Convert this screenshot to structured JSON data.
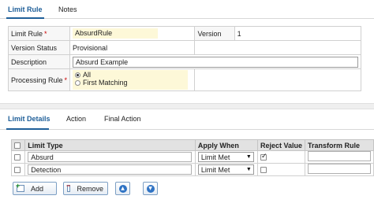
{
  "top_tabs": [
    {
      "label": "Limit Rule",
      "active": true
    },
    {
      "label": "Notes",
      "active": false
    }
  ],
  "limit_rule": {
    "limit_rule_label": "Limit Rule",
    "limit_rule_value": "AbsurdRule",
    "version_label": "Version",
    "version_value": "1",
    "version_status_label": "Version Status",
    "version_status_value": "Provisional",
    "description_label": "Description",
    "description_value": "Absurd Example",
    "processing_rule_label": "Processing Rule",
    "processing_options": [
      {
        "label": "All",
        "selected": true
      },
      {
        "label": "First Matching",
        "selected": false
      }
    ],
    "required_marker": "*"
  },
  "detail_tabs": [
    {
      "label": "Limit Details",
      "active": true
    },
    {
      "label": "Action",
      "active": false
    },
    {
      "label": "Final Action",
      "active": false
    }
  ],
  "grid": {
    "headers": [
      "Limit Type",
      "Apply When",
      "Reject Value",
      "Transform Rule"
    ],
    "rows": [
      {
        "limit_type": "Absurd",
        "apply_when": "Limit Met",
        "reject": true,
        "transform": ""
      },
      {
        "limit_type": "Detection",
        "apply_when": "Limit Met",
        "reject": false,
        "transform": ""
      }
    ]
  },
  "buttons": {
    "add": "Add",
    "remove": "Remove"
  },
  "icons": {
    "move_up": "circle-arrow-up-icon",
    "move_down": "circle-arrow-down-icon"
  },
  "colors": {
    "accent": "#1f5f99",
    "required": "#cc0000",
    "field_highlight": "#fdf8d8",
    "grid_header": "#e2e2e2"
  }
}
